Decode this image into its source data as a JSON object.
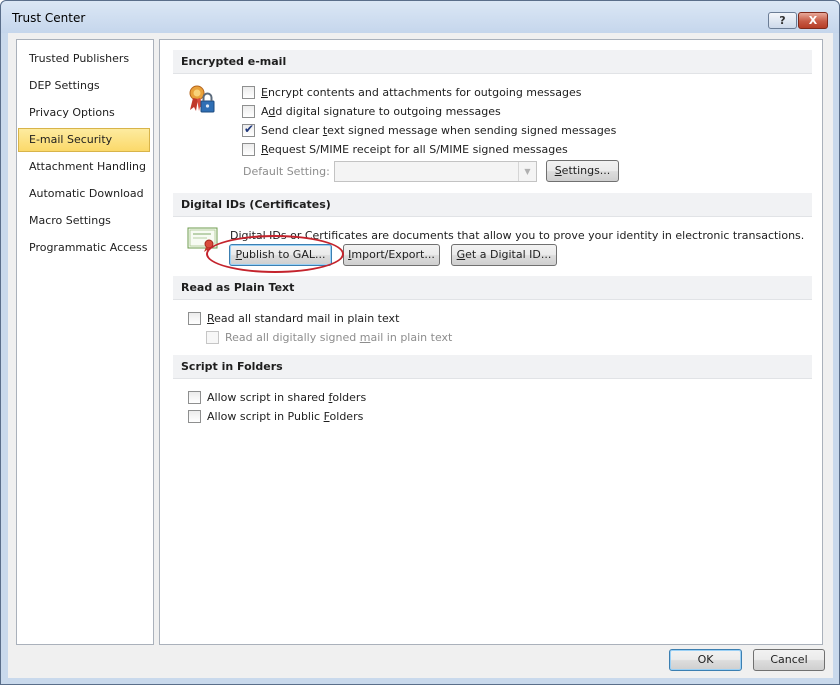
{
  "window": {
    "title": "Trust Center",
    "help_label": "?",
    "close_label": "X"
  },
  "sidebar": {
    "items": [
      {
        "label": "Trusted Publishers"
      },
      {
        "label": "DEP Settings"
      },
      {
        "label": "Privacy Options"
      },
      {
        "label": "E-mail Security",
        "selected": true
      },
      {
        "label": "Attachment Handling"
      },
      {
        "label": "Automatic Download"
      },
      {
        "label": "Macro Settings"
      },
      {
        "label": "Programmatic Access"
      }
    ]
  },
  "encrypted": {
    "header": "Encrypted e-mail",
    "options": [
      {
        "pre": "",
        "key": "E",
        "post": "ncrypt contents and attachments for outgoing messages",
        "checked": false
      },
      {
        "pre": "A",
        "key": "d",
        "post": "d digital signature to outgoing messages",
        "checked": false
      },
      {
        "pre": "Send clear ",
        "key": "t",
        "post": "ext signed message when sending signed messages",
        "checked": true
      },
      {
        "pre": "",
        "key": "R",
        "post": "equest S/MIME receipt for all S/MIME signed messages",
        "checked": false
      }
    ],
    "default_setting": {
      "pre": "Default Setting",
      "key": "",
      "post": ":",
      "value": ""
    },
    "settings_button": {
      "pre": "",
      "key": "S",
      "post": "ettings..."
    }
  },
  "digital_ids": {
    "header": "Digital IDs (Certificates)",
    "description": "Digital IDs or Certificates are documents that allow you to prove your identity in electronic transactions.",
    "buttons": [
      {
        "pre": "",
        "key": "P",
        "post": "ublish to GAL..."
      },
      {
        "pre": "",
        "key": "I",
        "post": "mport/Export..."
      },
      {
        "pre": "",
        "key": "G",
        "post": "et a Digital ID..."
      }
    ]
  },
  "plain_text": {
    "header": "Read as Plain Text",
    "options": [
      {
        "pre": "",
        "key": "R",
        "post": "ead all standard mail in plain text",
        "checked": false,
        "disabled": false
      },
      {
        "pre": "Read all digitally signed ",
        "key": "m",
        "post": "ail in plain text",
        "checked": false,
        "disabled": true
      }
    ]
  },
  "script": {
    "header": "Script in Folders",
    "options": [
      {
        "pre": "Allow script in shared ",
        "key": "f",
        "post": "olders",
        "checked": false
      },
      {
        "pre": "Allow script in Public ",
        "key": "F",
        "post": "olders",
        "checked": false
      }
    ]
  },
  "footer": {
    "ok_label": "OK",
    "cancel_label": "Cancel"
  },
  "colors": {
    "selection": "#fbd96a",
    "annotation_oval": "#c4232c",
    "title_bar": "#c9d9ec"
  },
  "icons": [
    "ribbon-lock-icon",
    "certificate-icon"
  ]
}
